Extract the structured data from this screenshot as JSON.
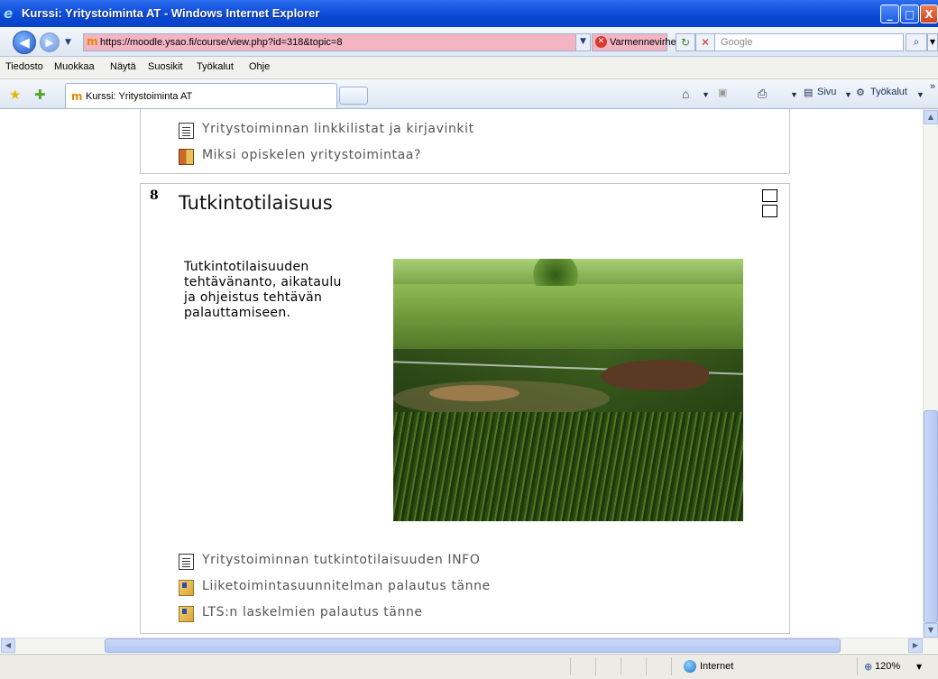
{
  "window": {
    "title": "Kurssi: Yritystoiminta AT - Windows Internet Explorer",
    "controls": {
      "minimize": "_",
      "maximize": "□",
      "close": "X"
    }
  },
  "address_bar": {
    "url": "https://moodle.ysao.fi/course/view.php?id=318&topic=8",
    "cert_warning": "Varmennevirhe",
    "search_placeholder": "Google"
  },
  "menu": [
    "Tiedosto",
    "Muokkaa",
    "Näytä",
    "Suosikit",
    "Työkalut",
    "Ohje"
  ],
  "tabs": [
    {
      "label": "Kurssi: Yritystoiminta AT",
      "active": true
    }
  ],
  "toolbar_right": {
    "page": "Sivu",
    "tools": "Työkalut",
    "more": "»"
  },
  "course": {
    "previous_section": [
      {
        "icon": "document-icon",
        "label": "Yritystoiminnan linkkilistat ja kirjavinkit"
      },
      {
        "icon": "quiz-icon",
        "label": "Miksi opiskelen yritystoimintaa?"
      }
    ],
    "section": {
      "number": "8",
      "title": "Tutkintotilaisuus",
      "description": "Tutkintotilaisuuden tehtävänanto, aikataulu ja ohjeistus tehtävän palauttamiseen.",
      "resources": [
        {
          "icon": "document-icon",
          "label": "Yritystoiminnan tutkintotilaisuuden INFO"
        },
        {
          "icon": "assignment-upload-icon",
          "label": "Liiketoimintasuunnitelman palautus tänne"
        },
        {
          "icon": "assignment-upload-icon",
          "label": "LTS:n laskelmien palautus tänne"
        }
      ]
    }
  },
  "status_bar": {
    "zone": "Internet",
    "zoom": "120%"
  },
  "colors": {
    "titlebar": "#0a49d4",
    "cert_error_bg": "#f3b5c2",
    "section_border": "#c7c7c7"
  }
}
